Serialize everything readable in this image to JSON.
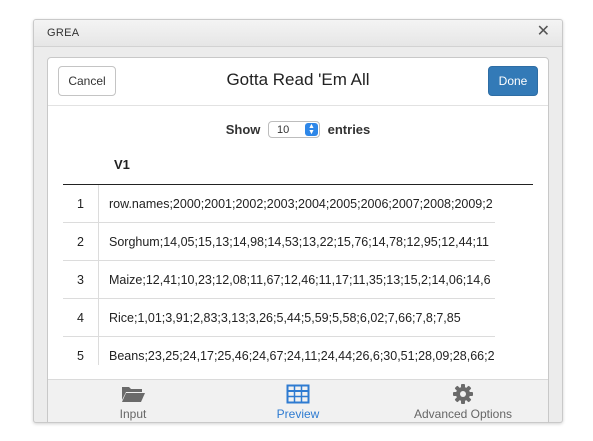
{
  "window": {
    "title": "GREA",
    "close_glyph": "✕"
  },
  "dialog": {
    "title": "Gotta Read 'Em All",
    "cancel_label": "Cancel",
    "done_label": "Done"
  },
  "length_control": {
    "show_label": "Show",
    "selected": "10",
    "entries_label": "entries"
  },
  "table": {
    "column_header": "V1",
    "rows": [
      {
        "index": "1",
        "value": "row.names;2000;2001;2002;2003;2004;2005;2006;2007;2008;2009;2"
      },
      {
        "index": "2",
        "value": "Sorghum;14,05;15,13;14,98;14,53;13,22;15,76;14,78;12,95;12,44;11"
      },
      {
        "index": "3",
        "value": "Maize;12,41;10,23;12,08;11,67;12,46;11,17;11,35;13;15,2;14,06;14,6"
      },
      {
        "index": "4",
        "value": "Rice;1,01;3,91;2,83;3,13;3,26;5,44;5,59;5,58;6,02;7,66;7,8;7,85"
      },
      {
        "index": "5",
        "value": "Beans;23,25;24,17;25,46;24,67;24,11;24,44;26,6;30,51;28,09;28,66;2"
      }
    ]
  },
  "tabs": [
    {
      "label": "Input",
      "icon": "folder-icon",
      "active": false
    },
    {
      "label": "Preview",
      "icon": "table-icon",
      "active": true
    },
    {
      "label": "Advanced Options",
      "icon": "gear-icon",
      "active": false
    }
  ],
  "colors": {
    "primary": "#337ab7",
    "active_tab": "#2e7bd1"
  }
}
